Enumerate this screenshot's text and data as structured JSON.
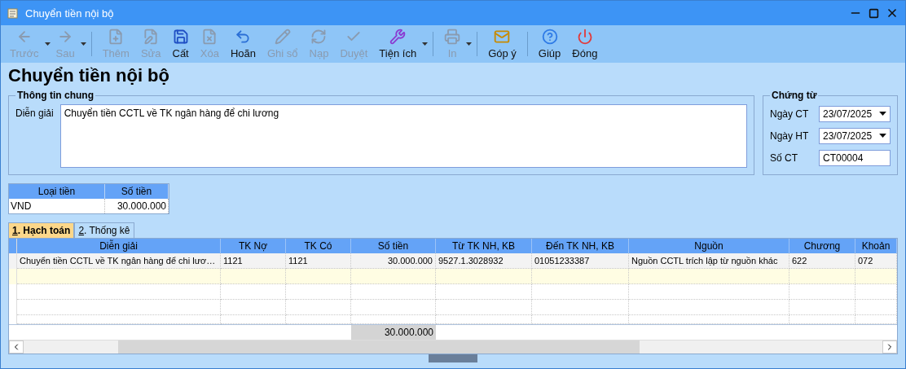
{
  "window": {
    "title": "Chuyển tiền nội bộ"
  },
  "toolbar": {
    "groups": [
      [
        {
          "kind": "back",
          "label": "Trước",
          "disabled": true,
          "dropdown": true
        },
        {
          "kind": "forward",
          "label": "Sau",
          "disabled": true,
          "dropdown": true
        }
      ],
      [
        {
          "kind": "add",
          "label": "Thêm",
          "disabled": true,
          "dropdown": false
        },
        {
          "kind": "edit",
          "label": "Sửa",
          "disabled": true,
          "dropdown": false
        },
        {
          "kind": "save",
          "label": "Cất",
          "disabled": false,
          "dropdown": false
        },
        {
          "kind": "delete",
          "label": "Xóa",
          "disabled": true,
          "dropdown": false
        },
        {
          "kind": "undo",
          "label": "Hoãn",
          "disabled": false,
          "dropdown": false
        },
        {
          "kind": "post",
          "label": "Ghi sổ",
          "disabled": true,
          "dropdown": false
        },
        {
          "kind": "reload",
          "label": "Nạp",
          "disabled": true,
          "dropdown": false
        },
        {
          "kind": "approve",
          "label": "Duyệt",
          "disabled": true,
          "dropdown": false
        },
        {
          "kind": "tools",
          "label": "Tiện ích",
          "disabled": false,
          "dropdown": true
        }
      ],
      [
        {
          "kind": "print",
          "label": "In",
          "disabled": true,
          "dropdown": true
        }
      ],
      [
        {
          "kind": "feedback",
          "label": "Góp ý",
          "disabled": false,
          "dropdown": false
        }
      ],
      [
        {
          "kind": "help",
          "label": "Giúp",
          "disabled": false,
          "dropdown": false
        },
        {
          "kind": "close",
          "label": "Đóng",
          "disabled": false,
          "dropdown": false
        }
      ]
    ]
  },
  "heading": "Chuyển tiền nội bộ",
  "general": {
    "title": "Thông tin chung",
    "label": "Diễn giải",
    "value": "Chuyển tiền CCTL về TK ngân hàng để chi lương"
  },
  "voucher": {
    "title": "Chứng từ",
    "fields": [
      {
        "kind": "date",
        "label": "Ngày CT",
        "value": "23/07/2025"
      },
      {
        "kind": "date",
        "label": "Ngày HT",
        "value": "23/07/2025"
      },
      {
        "kind": "text",
        "label": "Số CT",
        "value": "CT00004"
      }
    ]
  },
  "currency": {
    "columns": [
      "Loại tiền",
      "Số tiền"
    ],
    "rows": [
      [
        "VND",
        "30.000.000"
      ]
    ]
  },
  "tabs": [
    {
      "key": "1",
      "label": ". Hạch toán",
      "selected": true
    },
    {
      "key": "2",
      "label": ". Thống kê",
      "selected": false
    }
  ],
  "grid": {
    "columns": [
      "Diễn giải",
      "TK Nợ",
      "TK Có",
      "Số tiền",
      "Từ TK NH, KB",
      "Đến TK NH, KB",
      "Nguồn",
      "Chương",
      "Khoản"
    ],
    "rows": [
      [
        "Chuyển tiền CCTL về TK ngân hàng để chi lươ…",
        "1121",
        "1121",
        "30.000.000",
        "9527.1.3028932",
        "01051233387",
        "Nguồn CCTL trích lập từ nguồn khác",
        "622",
        "072"
      ]
    ],
    "total": "30.000.000"
  }
}
